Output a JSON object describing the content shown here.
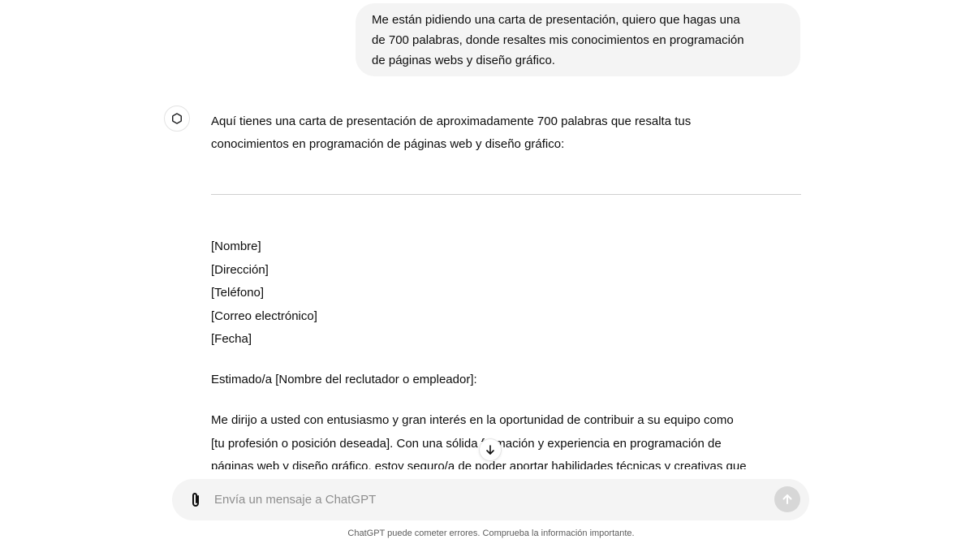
{
  "user_message": {
    "lines": [
      "Me están pidiendo una carta de presentación, quiero que hagas una",
      "de 700 palabras, donde resaltes mis conocimientos en programación",
      "de páginas webs y diseño gráfico."
    ]
  },
  "assistant": {
    "avatar_icon": "openai-logo-icon",
    "intro_lines": [
      "Aquí tienes una carta de presentación de aproximadamente 700 palabras que resalta tus",
      "conocimientos en programación de páginas web y diseño gráfico:"
    ],
    "letter_header": [
      "[Nombre]",
      "[Dirección]",
      "[Teléfono]",
      "[Correo electrónico]",
      "[Fecha]"
    ],
    "salutation": "Estimado/a [Nombre del reclutador o empleador]:",
    "body_lines": [
      "Me dirijo a usted con entusiasmo y gran interés en la oportunidad de contribuir a su equipo como",
      "[tu profesión o posición deseada]. Con una sólida formación y experiencia en programación de",
      "páginas web y diseño gráfico, estoy seguro/a de poder aportar habilidades técnicas y creativas que"
    ]
  },
  "scroll_button": {
    "icon": "arrow-down-icon"
  },
  "composer": {
    "attach_icon": "paperclip-icon",
    "placeholder": "Envía un mensaje a ChatGPT",
    "value": "",
    "send_icon": "arrow-up-icon"
  },
  "footer": {
    "note": "ChatGPT puede cometer errores. Comprueba la información importante."
  },
  "colors": {
    "user_bubble_bg": "#f4f4f4",
    "composer_bg": "#f4f4f4",
    "send_button_disabled": "#d7d7d7",
    "text": "#0d0d0d",
    "muted": "#5d5d5d"
  }
}
